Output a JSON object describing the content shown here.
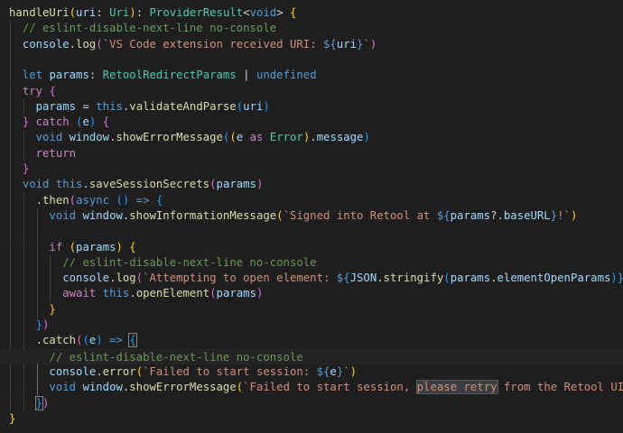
{
  "editor": {
    "lines": [
      [
        {
          "t": "handleUri",
          "c": "fn"
        },
        {
          "t": "(",
          "c": "br1"
        },
        {
          "t": "uri",
          "c": "var"
        },
        {
          "t": ": ",
          "c": "op"
        },
        {
          "t": "Uri",
          "c": "ty"
        },
        {
          "t": ")",
          "c": "br1"
        },
        {
          "t": ": ",
          "c": "op"
        },
        {
          "t": "ProviderResult",
          "c": "ty"
        },
        {
          "t": "<",
          "c": "op"
        },
        {
          "t": "void",
          "c": "kw"
        },
        {
          "t": "> ",
          "c": "op"
        },
        {
          "t": "{",
          "c": "br1"
        }
      ],
      [
        {
          "t": "  ",
          "c": "op"
        },
        {
          "t": "// eslint-disable-next-line no-console",
          "c": "com"
        }
      ],
      [
        {
          "t": "  ",
          "c": "op"
        },
        {
          "t": "console",
          "c": "var"
        },
        {
          "t": ".",
          "c": "op"
        },
        {
          "t": "log",
          "c": "fn"
        },
        {
          "t": "(",
          "c": "br2"
        },
        {
          "t": "`VS Code extension received URI: ",
          "c": "str"
        },
        {
          "t": "${",
          "c": "kw"
        },
        {
          "t": "uri",
          "c": "var"
        },
        {
          "t": "}",
          "c": "kw"
        },
        {
          "t": "`",
          "c": "str"
        },
        {
          "t": ")",
          "c": "br2"
        }
      ],
      [],
      [
        {
          "t": "  ",
          "c": "op"
        },
        {
          "t": "let",
          "c": "kw"
        },
        {
          "t": " ",
          "c": "op"
        },
        {
          "t": "params",
          "c": "var"
        },
        {
          "t": ": ",
          "c": "op"
        },
        {
          "t": "RetoolRedirectParams",
          "c": "ty"
        },
        {
          "t": " | ",
          "c": "op"
        },
        {
          "t": "undefined",
          "c": "kw"
        }
      ],
      [
        {
          "t": "  ",
          "c": "op"
        },
        {
          "t": "try",
          "c": "ctl"
        },
        {
          "t": " ",
          "c": "op"
        },
        {
          "t": "{",
          "c": "br2"
        }
      ],
      [
        {
          "t": "    ",
          "c": "op"
        },
        {
          "t": "params",
          "c": "var"
        },
        {
          "t": " = ",
          "c": "op"
        },
        {
          "t": "this",
          "c": "kw"
        },
        {
          "t": ".",
          "c": "op"
        },
        {
          "t": "validateAndParse",
          "c": "fn"
        },
        {
          "t": "(",
          "c": "br3"
        },
        {
          "t": "uri",
          "c": "var"
        },
        {
          "t": ")",
          "c": "br3"
        }
      ],
      [
        {
          "t": "  ",
          "c": "op"
        },
        {
          "t": "}",
          "c": "br2"
        },
        {
          "t": " ",
          "c": "op"
        },
        {
          "t": "catch",
          "c": "ctl"
        },
        {
          "t": " ",
          "c": "op"
        },
        {
          "t": "(",
          "c": "br3"
        },
        {
          "t": "e",
          "c": "var"
        },
        {
          "t": ")",
          "c": "br3"
        },
        {
          "t": " ",
          "c": "op"
        },
        {
          "t": "{",
          "c": "br2"
        }
      ],
      [
        {
          "t": "    ",
          "c": "op"
        },
        {
          "t": "void",
          "c": "kw"
        },
        {
          "t": " ",
          "c": "op"
        },
        {
          "t": "window",
          "c": "var"
        },
        {
          "t": ".",
          "c": "op"
        },
        {
          "t": "showErrorMessage",
          "c": "fn"
        },
        {
          "t": "(",
          "c": "br3"
        },
        {
          "t": "(",
          "c": "br1"
        },
        {
          "t": "e",
          "c": "var"
        },
        {
          "t": " ",
          "c": "op"
        },
        {
          "t": "as",
          "c": "ctl"
        },
        {
          "t": " ",
          "c": "op"
        },
        {
          "t": "Error",
          "c": "ty"
        },
        {
          "t": ")",
          "c": "br1"
        },
        {
          "t": ".",
          "c": "op"
        },
        {
          "t": "message",
          "c": "var"
        },
        {
          "t": ")",
          "c": "br3"
        }
      ],
      [
        {
          "t": "    ",
          "c": "op"
        },
        {
          "t": "return",
          "c": "ctl"
        }
      ],
      [
        {
          "t": "  ",
          "c": "op"
        },
        {
          "t": "}",
          "c": "br2"
        }
      ],
      [
        {
          "t": "  ",
          "c": "op"
        },
        {
          "t": "void",
          "c": "kw"
        },
        {
          "t": " ",
          "c": "op"
        },
        {
          "t": "this",
          "c": "kw"
        },
        {
          "t": ".",
          "c": "op"
        },
        {
          "t": "saveSessionSecrets",
          "c": "fn"
        },
        {
          "t": "(",
          "c": "br2"
        },
        {
          "t": "params",
          "c": "var"
        },
        {
          "t": ")",
          "c": "br2"
        }
      ],
      [
        {
          "t": "    ",
          "c": "op"
        },
        {
          "t": ".",
          "c": "op"
        },
        {
          "t": "then",
          "c": "fn"
        },
        {
          "t": "(",
          "c": "br2"
        },
        {
          "t": "async",
          "c": "kw"
        },
        {
          "t": " ",
          "c": "op"
        },
        {
          "t": "()",
          "c": "br3"
        },
        {
          "t": " ",
          "c": "op"
        },
        {
          "t": "=>",
          "c": "kw"
        },
        {
          "t": " ",
          "c": "op"
        },
        {
          "t": "{",
          "c": "br3"
        }
      ],
      [
        {
          "t": "      ",
          "c": "op"
        },
        {
          "t": "void",
          "c": "kw"
        },
        {
          "t": " ",
          "c": "op"
        },
        {
          "t": "window",
          "c": "var"
        },
        {
          "t": ".",
          "c": "op"
        },
        {
          "t": "showInformationMessage",
          "c": "fn"
        },
        {
          "t": "(",
          "c": "br1"
        },
        {
          "t": "`Signed into Retool at ",
          "c": "str"
        },
        {
          "t": "${",
          "c": "kw"
        },
        {
          "t": "params",
          "c": "var"
        },
        {
          "t": "?.",
          "c": "op"
        },
        {
          "t": "baseURL",
          "c": "var"
        },
        {
          "t": "}",
          "c": "kw"
        },
        {
          "t": "!`",
          "c": "str"
        },
        {
          "t": ")",
          "c": "br1"
        }
      ],
      [],
      [
        {
          "t": "      ",
          "c": "op"
        },
        {
          "t": "if",
          "c": "ctl"
        },
        {
          "t": " ",
          "c": "op"
        },
        {
          "t": "(",
          "c": "br1"
        },
        {
          "t": "params",
          "c": "var"
        },
        {
          "t": ")",
          "c": "br1"
        },
        {
          "t": " ",
          "c": "op"
        },
        {
          "t": "{",
          "c": "br1"
        }
      ],
      [
        {
          "t": "        ",
          "c": "op"
        },
        {
          "t": "// eslint-disable-next-line no-console",
          "c": "com"
        }
      ],
      [
        {
          "t": "        ",
          "c": "op"
        },
        {
          "t": "console",
          "c": "var"
        },
        {
          "t": ".",
          "c": "op"
        },
        {
          "t": "log",
          "c": "fn"
        },
        {
          "t": "(",
          "c": "br2"
        },
        {
          "t": "`Attempting to open element: ",
          "c": "str"
        },
        {
          "t": "${",
          "c": "kw"
        },
        {
          "t": "JSON",
          "c": "var"
        },
        {
          "t": ".",
          "c": "op"
        },
        {
          "t": "stringify",
          "c": "fn"
        },
        {
          "t": "(",
          "c": "br3"
        },
        {
          "t": "params",
          "c": "var"
        },
        {
          "t": ".",
          "c": "op"
        },
        {
          "t": "elementOpenParams",
          "c": "var"
        },
        {
          "t": ")",
          "c": "br3"
        },
        {
          "t": "}",
          "c": "kw"
        },
        {
          "t": "`",
          "c": "str"
        },
        {
          "t": ")",
          "c": "br2"
        }
      ],
      [
        {
          "t": "        ",
          "c": "op"
        },
        {
          "t": "await",
          "c": "ctl"
        },
        {
          "t": " ",
          "c": "op"
        },
        {
          "t": "this",
          "c": "kw"
        },
        {
          "t": ".",
          "c": "op"
        },
        {
          "t": "openElement",
          "c": "fn"
        },
        {
          "t": "(",
          "c": "br2"
        },
        {
          "t": "params",
          "c": "var"
        },
        {
          "t": ")",
          "c": "br2"
        }
      ],
      [
        {
          "t": "      ",
          "c": "op"
        },
        {
          "t": "}",
          "c": "br1"
        }
      ],
      [
        {
          "t": "    ",
          "c": "op"
        },
        {
          "t": "}",
          "c": "br3"
        },
        {
          "t": ")",
          "c": "br2"
        }
      ],
      [
        {
          "t": "    ",
          "c": "op"
        },
        {
          "t": ".",
          "c": "op"
        },
        {
          "t": "catch",
          "c": "fn"
        },
        {
          "t": "(",
          "c": "br2"
        },
        {
          "t": "(",
          "c": "br3"
        },
        {
          "t": "e",
          "c": "var"
        },
        {
          "t": ")",
          "c": "br3"
        },
        {
          "t": " ",
          "c": "op"
        },
        {
          "t": "=>",
          "c": "kw"
        },
        {
          "t": " ",
          "c": "op"
        },
        {
          "t": "{",
          "c": "br3",
          "m": true
        }
      ],
      [
        {
          "t": "      ",
          "c": "op"
        },
        {
          "t": "// eslint-disable-next-line no-console",
          "c": "com"
        }
      ],
      [
        {
          "t": "      ",
          "c": "op"
        },
        {
          "t": "console",
          "c": "var"
        },
        {
          "t": ".",
          "c": "op"
        },
        {
          "t": "error",
          "c": "fn"
        },
        {
          "t": "(",
          "c": "br1"
        },
        {
          "t": "`Failed to start session: ",
          "c": "str"
        },
        {
          "t": "${",
          "c": "kw"
        },
        {
          "t": "e",
          "c": "var"
        },
        {
          "t": "}",
          "c": "kw"
        },
        {
          "t": "`",
          "c": "str"
        },
        {
          "t": ")",
          "c": "br1"
        }
      ],
      [
        {
          "t": "      ",
          "c": "op"
        },
        {
          "t": "void",
          "c": "kw"
        },
        {
          "t": " ",
          "c": "op"
        },
        {
          "t": "window",
          "c": "var"
        },
        {
          "t": ".",
          "c": "op"
        },
        {
          "t": "showErrorMessage",
          "c": "fn"
        },
        {
          "t": "(",
          "c": "br1"
        },
        {
          "t": "`Failed to start session, ",
          "c": "str"
        },
        {
          "t": "please retry",
          "c": "str",
          "h": true
        },
        {
          "t": " from the Retool UI`",
          "c": "str"
        },
        {
          "t": ")",
          "c": "br1"
        }
      ],
      [
        {
          "t": "    ",
          "c": "op"
        },
        {
          "t": "}",
          "c": "br3",
          "m": true
        },
        {
          "t": ")",
          "c": "br2"
        }
      ],
      [
        {
          "t": "}",
          "c": "br1"
        }
      ]
    ]
  }
}
